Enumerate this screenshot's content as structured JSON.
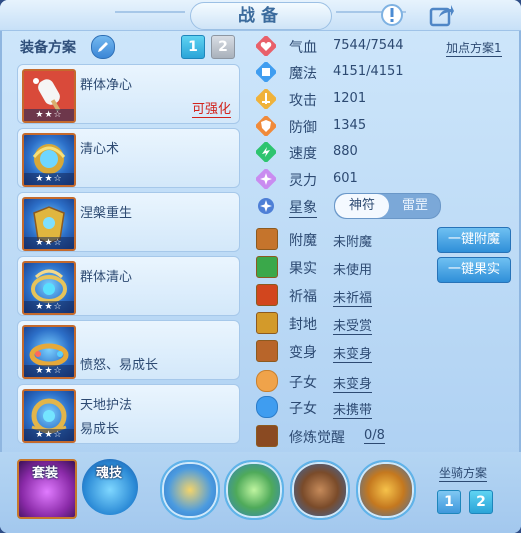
{
  "title": "战备",
  "header_icons": [
    "alert-icon",
    "share-icon"
  ],
  "equipment": {
    "plan_label": "装备方案",
    "plans": [
      "1",
      "2"
    ],
    "active_plan": "1"
  },
  "skills": [
    {
      "name": "群体净心",
      "sub": "",
      "upgrade": "可强化",
      "stars": "★★☆"
    },
    {
      "name": "清心术",
      "sub": "",
      "upgrade": "",
      "stars": "★★☆"
    },
    {
      "name": "涅槃重生",
      "sub": "",
      "upgrade": "",
      "stars": "★★☆"
    },
    {
      "name": "群体清心",
      "sub": "",
      "upgrade": "",
      "stars": "★★☆"
    },
    {
      "name": "",
      "sub": "愤怒、易成长",
      "upgrade": "",
      "stars": "★★☆"
    },
    {
      "name": "天地护法",
      "sub": "易成长",
      "upgrade": "",
      "stars": "★★☆"
    }
  ],
  "attributes": {
    "plan_link": "加点方案1",
    "items": [
      {
        "name": "气血",
        "value": "7544/7544",
        "icon": "heart-icon"
      },
      {
        "name": "魔法",
        "value": "4151/4151",
        "icon": "mana-icon"
      },
      {
        "name": "攻击",
        "value": "1201",
        "icon": "attack-icon"
      },
      {
        "name": "防御",
        "value": "1345",
        "icon": "defense-icon"
      },
      {
        "name": "速度",
        "value": "880",
        "icon": "speed-icon"
      },
      {
        "name": "灵力",
        "value": "601",
        "icon": "spirit-icon"
      }
    ],
    "star_sign": {
      "name": "星象",
      "options": [
        "神符",
        "雷罡"
      ],
      "selected": "神符"
    }
  },
  "status": [
    {
      "name": "附魔",
      "value": "未附魔",
      "underline": false,
      "icon": "enchant-icon"
    },
    {
      "name": "果实",
      "value": "未使用",
      "underline": false,
      "icon": "fruit-icon"
    },
    {
      "name": "祈福",
      "value": "未祈福",
      "underline": true,
      "icon": "blessing-icon"
    },
    {
      "name": "封地",
      "value": "未受赏",
      "underline": true,
      "icon": "fief-icon"
    },
    {
      "name": "变身",
      "value": "未变身",
      "underline": true,
      "icon": "transform-icon"
    },
    {
      "name": "子女",
      "value": "未变身",
      "underline": true,
      "icon": "child-icon"
    },
    {
      "name": "子女",
      "value": "未携带",
      "underline": true,
      "icon": "paw-icon"
    },
    {
      "name": "修炼觉醒",
      "value": "0/8",
      "underline": true,
      "icon": "awaken-icon"
    }
  ],
  "actions": {
    "enchant_all": "一键附魔",
    "fruit_all": "一键果实"
  },
  "bottom": {
    "tab_suit": "套装",
    "tab_soul": "魂技",
    "orbs": [
      "golden-figure-icon",
      "green-leaf-icon",
      "beast-icon",
      "golden-bow-icon"
    ],
    "mount_label": "坐骑方案",
    "mount_plans": [
      "1",
      "2"
    ],
    "mount_active": "2"
  },
  "colors": {
    "accent_blue": "#2f8fd8",
    "upgrade_red": "#d2231c",
    "text": "#2d4a72"
  }
}
